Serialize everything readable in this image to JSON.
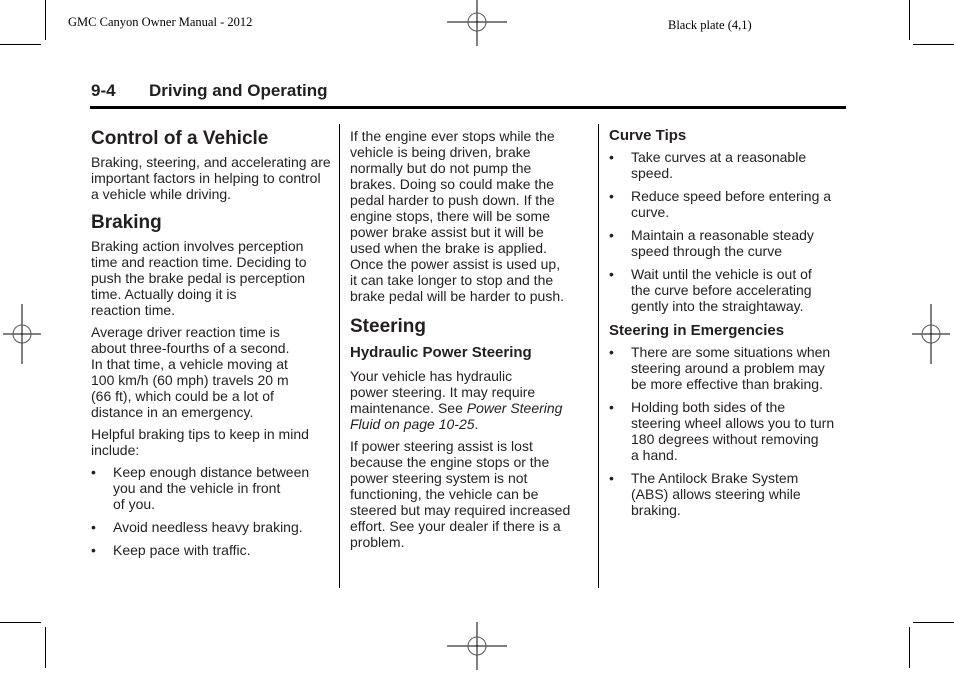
{
  "running_head": {
    "left": "GMC Canyon Owner Manual - 2012",
    "right": "Black plate (4,1)"
  },
  "page_header": {
    "page_number": "9-4",
    "section": "Driving and Operating"
  },
  "column1": {
    "title_control": "Control of a Vehicle",
    "control_text": "Braking, steering, and accelerating are important factors in helping to control a vehicle while driving.",
    "title_braking": "Braking",
    "braking_p1_lines": [
      "Braking action involves perception",
      "time and reaction time. Deciding to",
      "push the brake pedal is perception",
      "time. Actually doing it is",
      "reaction time."
    ],
    "braking_p2_lines": [
      "Average driver reaction time is",
      "about three-fourths of a second.",
      "In that time, a vehicle moving at",
      "100 km/h (60 mph) travels 20 m",
      "(66 ft), which could be a lot of",
      "distance in an emergency."
    ],
    "braking_p3_lines": [
      "Helpful braking tips to keep in mind",
      "include:"
    ],
    "bullets": [
      [
        "Keep enough distance between",
        "you and the vehicle in front",
        "of you."
      ],
      [
        "Avoid needless heavy braking."
      ],
      [
        "Keep pace with traffic."
      ]
    ],
    "bullet_glyph": "•"
  },
  "column2": {
    "engine_stop_lines": [
      "If the engine ever stops while the",
      "vehicle is being driven, brake",
      "normally but do not pump the",
      "brakes. Doing so could make the",
      "pedal harder to push down. If the",
      "engine stops, there will be some",
      "power brake assist but it will be",
      "used when the brake is applied.",
      "Once the power assist is used up,",
      "it can take longer to stop and the",
      "brake pedal will be harder to push."
    ],
    "title_steering": "Steering",
    "subtitle_hps": "Hydraulic Power Steering",
    "hps_line1": "Your vehicle has hydraulic",
    "hps_line2": "power steering. It may require",
    "hps_line3_plain": "maintenance. See ",
    "hps_line3_italic": "Power Steering",
    "hps_line4_italic": "Fluid on page 10-25",
    "hps_line4_tail": ".",
    "assist_lost_lines": [
      "If power steering assist is lost",
      "because the engine stops or the",
      "power steering system is not",
      "functioning, the vehicle can be",
      "steered but may required increased",
      "effort. See your dealer if there is a",
      "problem."
    ]
  },
  "column3": {
    "title_curve": "Curve Tips",
    "curve_bullets": [
      [
        "Take curves at a reasonable",
        "speed."
      ],
      [
        "Reduce speed before entering a",
        "curve."
      ],
      [
        "Maintain a reasonable steady",
        "speed through the curve"
      ],
      [
        "Wait until the vehicle is out of",
        "the curve before accelerating",
        "gently into the straightaway."
      ]
    ],
    "title_emergencies": "Steering in Emergencies",
    "emergency_bullets": [
      [
        "There are some situations when",
        "steering around a problem may",
        "be more effective than braking."
      ],
      [
        "Holding both sides of the",
        "steering wheel allows you to turn",
        "180 degrees without removing",
        "a hand."
      ],
      [
        "The Antilock Brake System",
        "(ABS) allows steering while",
        "braking."
      ]
    ],
    "bullet_glyph": "•"
  }
}
